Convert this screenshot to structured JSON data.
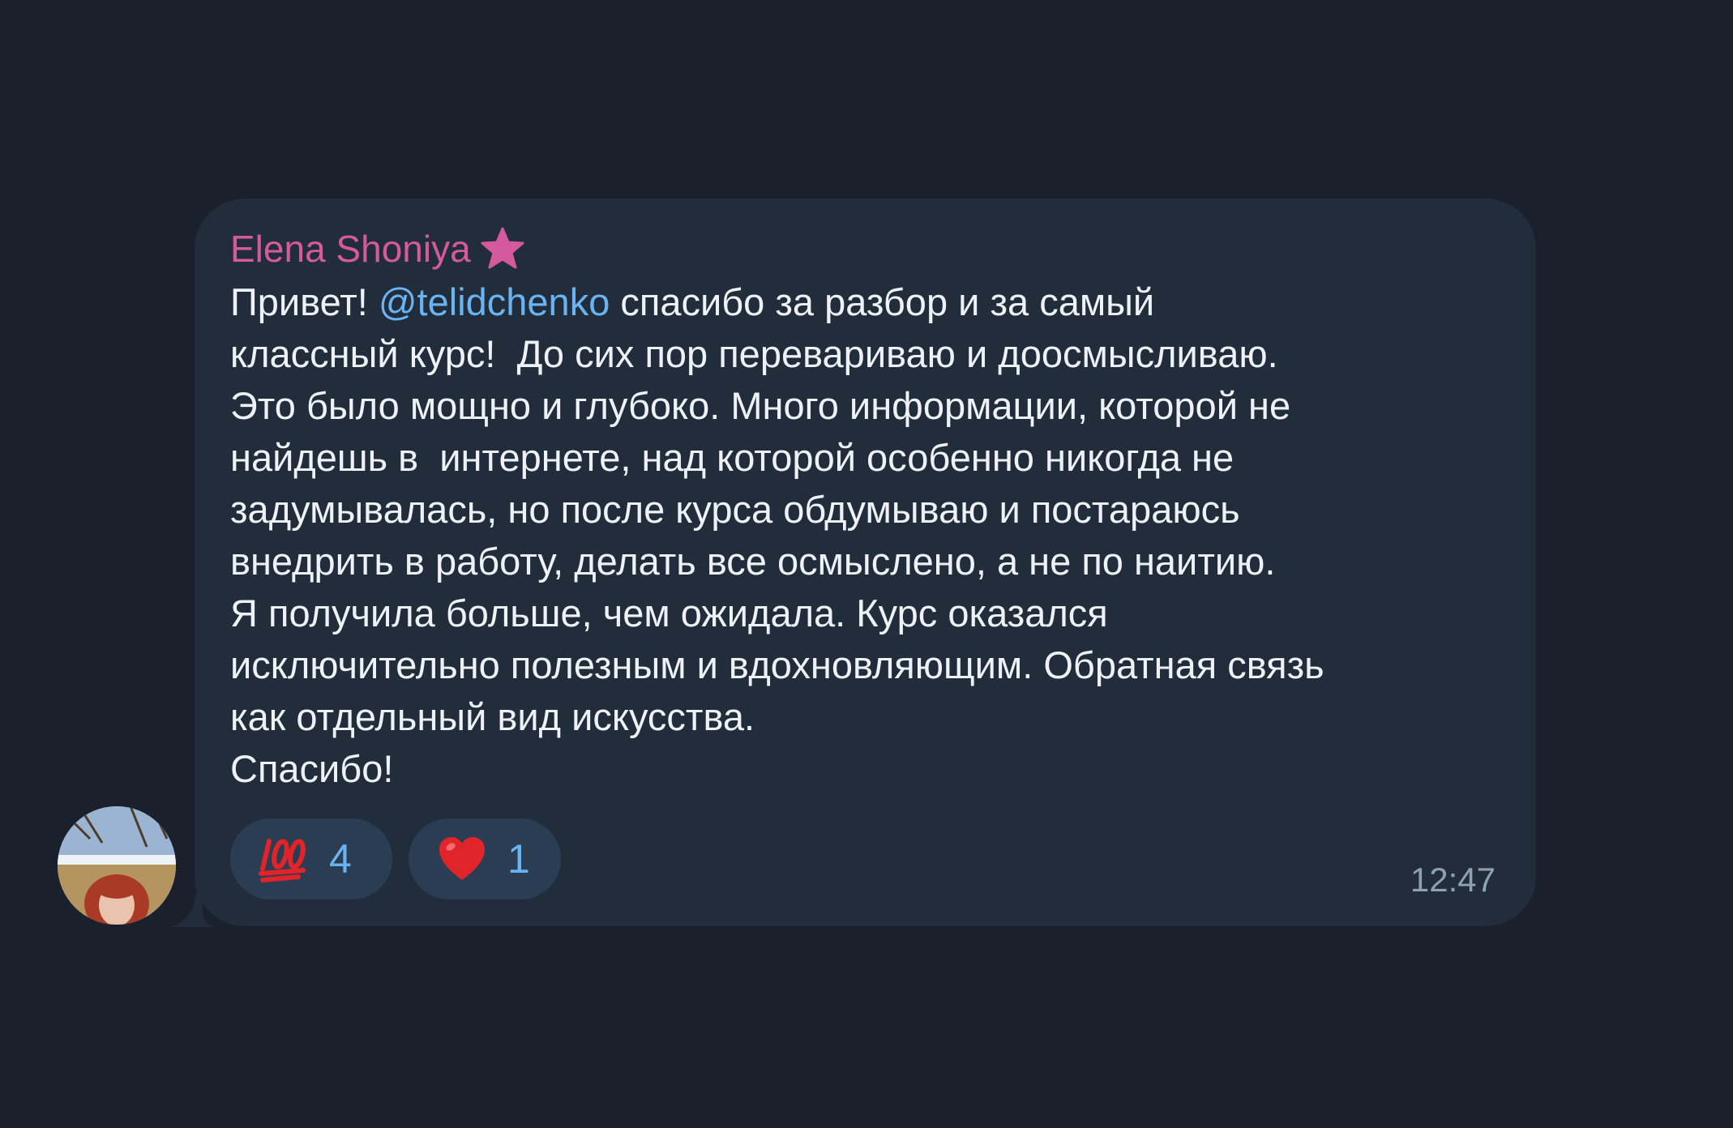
{
  "message": {
    "sender": "Elena Shoniya",
    "sender_badge_icon": "star-icon",
    "text_before_mention": "Привет! ",
    "mention": "@telidchenko",
    "text_after_mention": " спасибо за разбор и за самый\nклассный курс!  До сих пор перевариваю и доосмысливаю.\nЭто было мощно и глубоко. Много информации, которой не\nнайдешь в  интернете, над которой особенно никогда не\nзадумывалась, но после курса обдумываю и постараюсь\nвнедрить в работу, делать все осмыслено, а не по наитию.\nЯ получила больше, чем ожидала. Курс оказался\nисключительно полезным и вдохновляющим. Обратная связь\nкак отдельный вид искусства.\nСпасибо!",
    "time": "12:47"
  },
  "reactions": [
    {
      "emoji": "hundred-points-icon",
      "count": "4"
    },
    {
      "emoji": "heart-icon",
      "count": "1"
    }
  ],
  "colors": {
    "background": "#1a202c",
    "bubble": "#212d3b",
    "sender": "#d45a9d",
    "mention": "#6ab3f3",
    "reaction_bg": "#2b3d52",
    "time": "#8fa1b3"
  }
}
